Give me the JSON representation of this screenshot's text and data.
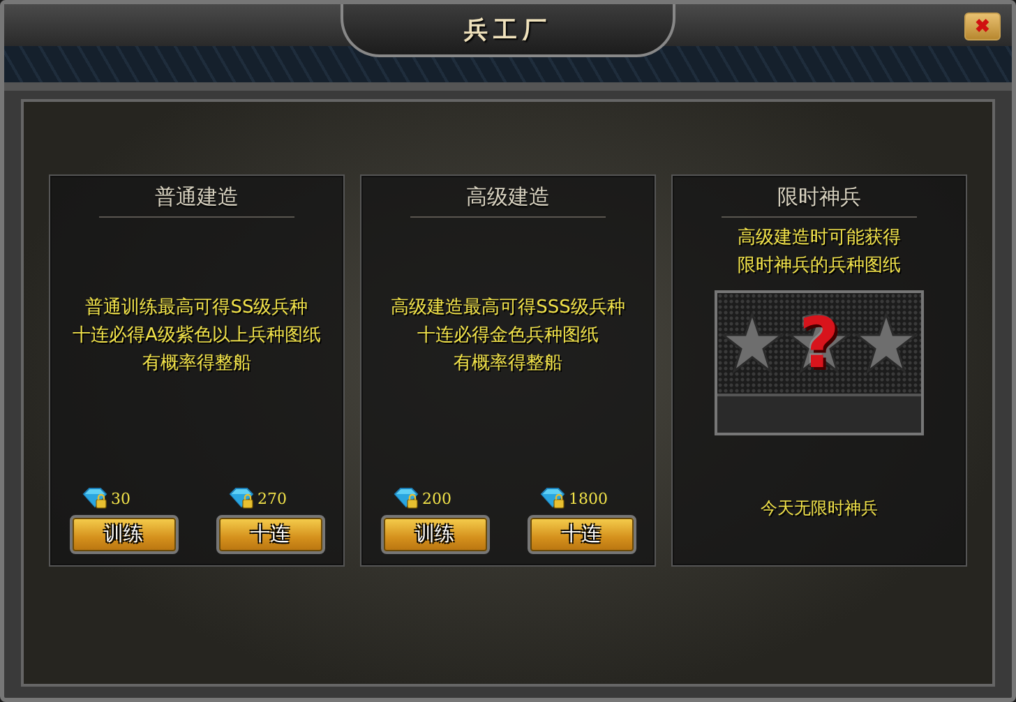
{
  "window": {
    "title": "兵工厂",
    "close": "✖"
  },
  "cards": [
    {
      "kind": "build",
      "title": "普通建造",
      "description": [
        "普通训练最高可得SS级兵种",
        "十连必得A级紫色以上兵种图纸",
        "有概率得整船"
      ],
      "options": [
        {
          "price": "30",
          "button": "训练"
        },
        {
          "price": "270",
          "button": "十连"
        }
      ]
    },
    {
      "kind": "build",
      "title": "高级建造",
      "description": [
        "高级建造最高可得SSS级兵种",
        "十连必得金色兵种图纸",
        "有概率得整船"
      ],
      "options": [
        {
          "price": "200",
          "button": "训练"
        },
        {
          "price": "1800",
          "button": "十连"
        }
      ]
    },
    {
      "kind": "limited",
      "title": "限时神兵",
      "description": [
        "高级建造时可能获得",
        "限时神兵的兵种图纸"
      ],
      "mystery": "?",
      "status": "今天无限时神兵"
    }
  ]
}
